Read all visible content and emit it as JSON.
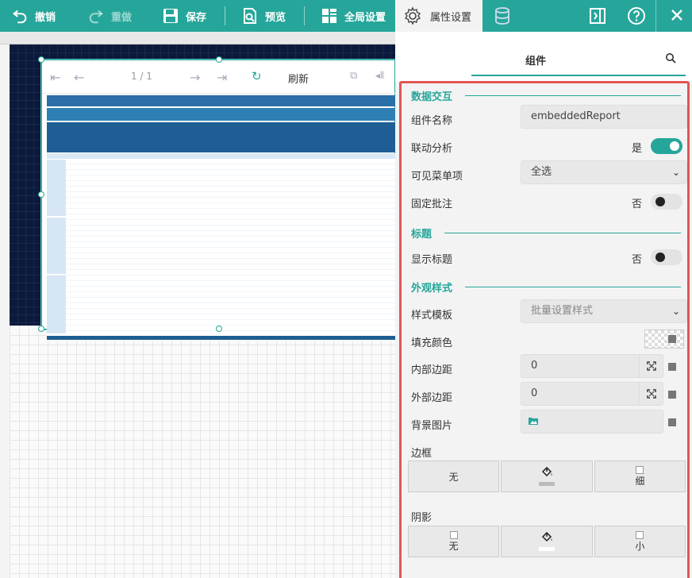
{
  "toolbar": {
    "undo": "撤销",
    "redo": "重做",
    "save": "保存",
    "preview": "预览",
    "global_settings": "全局设置",
    "property_settings": "属性设置"
  },
  "colors": {
    "accent": "#26a69a",
    "highlight_border": "#e05555",
    "report_header": "#1e5e94"
  },
  "embedded_report": {
    "page_indicator": "1 / 1",
    "refresh_label": "刷新"
  },
  "panel": {
    "header_tab": "组件",
    "sections": {
      "data_interaction": "数据交互",
      "title": "标题",
      "appearance": "外观样式"
    },
    "component_name": {
      "label": "组件名称",
      "value": "embeddedReport"
    },
    "linkage": {
      "label": "联动分析",
      "state_text": "是",
      "on": true
    },
    "visible_menu": {
      "label": "可见菜单项",
      "value": "全选"
    },
    "fixed_annotation": {
      "label": "固定批注",
      "state_text": "否",
      "on": false
    },
    "show_title": {
      "label": "显示标题",
      "state_text": "否",
      "on": false
    },
    "style_template": {
      "label": "样式模板",
      "value": "批量设置样式"
    },
    "fill_color": {
      "label": "填充颜色"
    },
    "padding": {
      "label": "内部边距",
      "value": "0"
    },
    "margin": {
      "label": "外部边距",
      "value": "0"
    },
    "background_image": {
      "label": "背景图片"
    },
    "border": {
      "label": "边框",
      "none": "无",
      "thin": "细"
    },
    "shadow": {
      "label": "阴影",
      "none": "无",
      "small": "小"
    }
  }
}
